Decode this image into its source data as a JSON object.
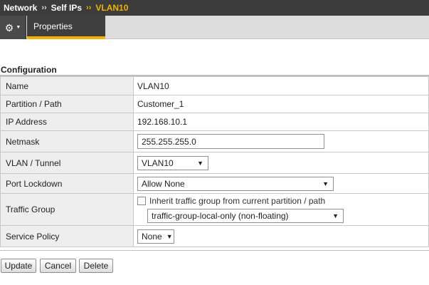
{
  "breadcrumb": {
    "items": [
      "Network",
      "Self IPs",
      "VLAN10"
    ],
    "separator": "››"
  },
  "toolbar": {
    "gear_icon": "gear-icon",
    "caret_icon": "caret-down-icon",
    "tab_label": "Properties"
  },
  "section": {
    "title": "Configuration"
  },
  "fields": {
    "name": {
      "label": "Name",
      "value": "VLAN10"
    },
    "partition": {
      "label": "Partition / Path",
      "value": "Customer_1"
    },
    "ip_address": {
      "label": "IP Address",
      "value": "192.168.10.1"
    },
    "netmask": {
      "label": "Netmask",
      "value": "255.255.255.0"
    },
    "vlan": {
      "label": "VLAN / Tunnel",
      "value": "VLAN10"
    },
    "port_lockdown": {
      "label": "Port Lockdown",
      "value": "Allow None"
    },
    "traffic_group": {
      "label": "Traffic Group",
      "inherit_label": "Inherit traffic group from current partition / path",
      "inherit_checked": false,
      "value": "traffic-group-local-only (non-floating)"
    },
    "service_policy": {
      "label": "Service Policy",
      "value": "None"
    }
  },
  "buttons": {
    "update": "Update",
    "cancel": "Cancel",
    "delete": "Delete"
  },
  "colors": {
    "breadcrumb_bg": "#3c3c3c",
    "accent": "#f0b400",
    "label_cell_bg": "#eeeeee"
  }
}
